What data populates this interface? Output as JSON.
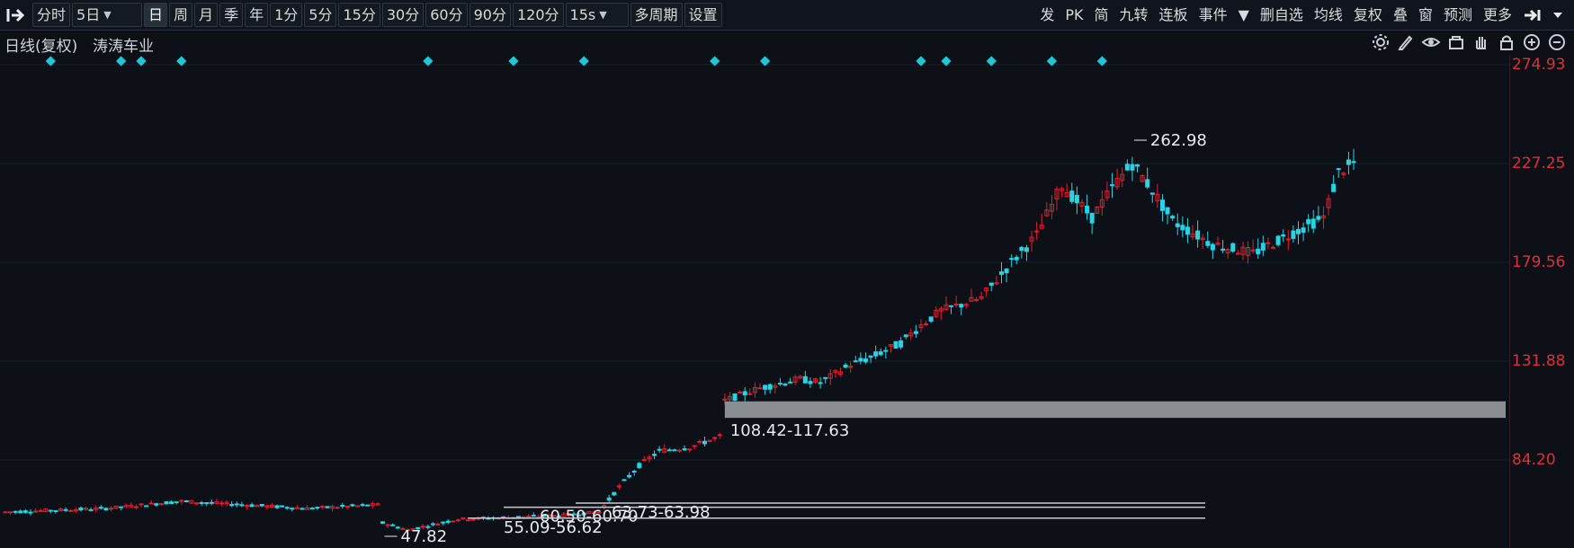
{
  "toolbar": {
    "left_icon": "collapse-arrow-icon",
    "items": [
      {
        "label": "分时"
      },
      {
        "label": "5日",
        "dropdown": true
      },
      {
        "label": "日",
        "active": true
      },
      {
        "label": "周"
      },
      {
        "label": "月"
      },
      {
        "label": "季"
      },
      {
        "label": "年"
      },
      {
        "label": "1分"
      },
      {
        "label": "5分"
      },
      {
        "label": "15分"
      },
      {
        "label": "30分"
      },
      {
        "label": "60分"
      },
      {
        "label": "90分"
      },
      {
        "label": "120分"
      },
      {
        "label": "15s",
        "dropdown": true
      },
      {
        "label": "多周期"
      },
      {
        "label": "设置"
      }
    ],
    "right_items": [
      {
        "label": "发"
      },
      {
        "label": "PK"
      },
      {
        "label": "简"
      },
      {
        "label": "九转"
      },
      {
        "label": "连板"
      },
      {
        "label": "事件"
      },
      {
        "label": "▼"
      },
      {
        "label": "删自选"
      },
      {
        "label": "均线"
      },
      {
        "label": "复权"
      },
      {
        "label": "叠"
      },
      {
        "label": "窗"
      },
      {
        "label": "预测"
      },
      {
        "label": "更多"
      }
    ]
  },
  "info": {
    "period_label": "日线(复权)",
    "stock_name": "涛涛车业",
    "tool_icons": [
      "gear-icon",
      "pen-icon",
      "eye-icon",
      "basket-icon",
      "hand-icon",
      "lock-icon",
      "zoom-in-icon",
      "zoom-out-icon"
    ]
  },
  "y_axis": {
    "labels": [
      "274.93",
      "227.25",
      "179.56",
      "131.88",
      "84.20"
    ],
    "color": "#e02f3a"
  },
  "chart_data": {
    "type": "candlestick",
    "up_color": "#e0202e",
    "down_color": "#29d3e6",
    "ylim": [
      60,
      275
    ],
    "price_annotations": [
      {
        "text": "262.98",
        "x_index": 224,
        "price": 262.98
      },
      {
        "text": "47.82",
        "x_index": 75,
        "price": 47.82
      }
    ],
    "gap_zone": {
      "label": "108.42-117.63",
      "low": 108.42,
      "high": 117.63,
      "start_index": 143
    },
    "gap_lines": [
      {
        "label": "60.50-60.70",
        "low": 60.5,
        "high": 60.7
      },
      {
        "label": "63.73-63.98",
        "low": 63.73,
        "high": 63.98
      },
      {
        "label": "55.09-56.62",
        "low": 55.09,
        "high": 56.62
      }
    ],
    "marker_color": "#1fc6d6",
    "marker_indices": [
      9,
      23,
      27,
      35,
      84,
      101,
      115,
      141,
      151,
      182,
      187,
      196,
      208,
      218
    ]
  }
}
